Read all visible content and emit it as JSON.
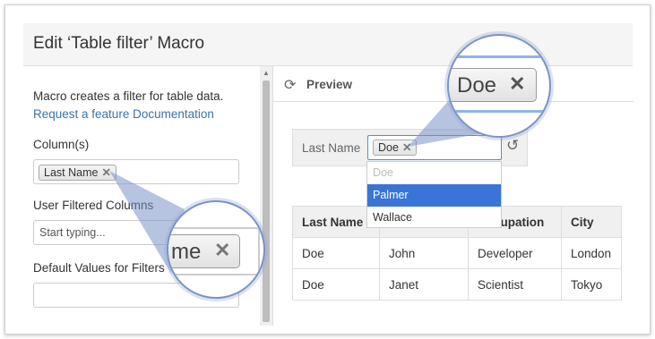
{
  "dialog": {
    "title": "Edit ‘Table filter’ Macro"
  },
  "left": {
    "description": "Macro creates a filter for table data.",
    "link_request": "Request a feature",
    "link_docs": "Documentation",
    "columns_label": "Column(s)",
    "columns_tag": "Last Name",
    "user_filtered_label": "User Filtered Columns",
    "user_filtered_placeholder": "Start typing...",
    "default_values_label": "Default Values for Filters",
    "default_values_value": ""
  },
  "preview": {
    "label": "Preview",
    "filter_label": "Last Name",
    "filter_tag": "Doe",
    "dropdown_options": [
      "Doe",
      "Palmer",
      "Wallace"
    ],
    "selected_option": "Palmer",
    "table": {
      "headers": [
        "Last Name",
        "",
        "Occupation",
        "City"
      ],
      "rows": [
        [
          "Doe",
          "John",
          "Developer",
          "London"
        ],
        [
          "Doe",
          "Janet",
          "Scientist",
          "Tokyo"
        ]
      ]
    }
  },
  "magnifier_left": {
    "text": "me"
  },
  "magnifier_right": {
    "text": "Doe"
  },
  "icons": {
    "close": "close-icon",
    "refresh": "refresh-icon",
    "reset": "undo-icon"
  },
  "colors": {
    "accent": "#3875d7",
    "link": "#3b73af",
    "magnifier_border": "#7b93c9"
  }
}
